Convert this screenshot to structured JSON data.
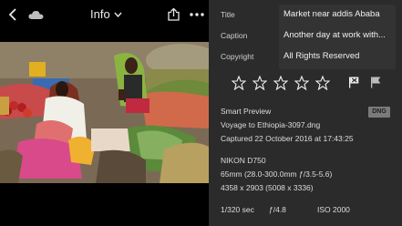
{
  "header": {
    "title": "Info",
    "icons": [
      "chevron-left-icon",
      "cloud-icon",
      "chevron-down-icon",
      "share-icon",
      "more-icon"
    ]
  },
  "photo": {
    "alt_icon": "market-photo"
  },
  "metadata": {
    "title_label": "Title",
    "title_value": "Market near addis Ababa",
    "caption_label": "Caption",
    "caption_value": "Another day at work with...",
    "copyright_label": "Copyright",
    "copyright_value": "All Rights Reserved"
  },
  "rating": {
    "stars_total": 5,
    "stars_filled": 0
  },
  "details": {
    "preview_type": "Smart Preview",
    "badge": "DNG",
    "filename": "Voyage to Ethiopia-3097.dng",
    "captured": "Captured 22 October 2016 at 17:43:25",
    "camera": "NIKON D750",
    "lens": "65mm (28.0-300.0mm ƒ/3.5-5.6)",
    "dimensions": "4358 x 2903 (5008 x 3336)",
    "shutter": "1/320 sec",
    "aperture": "ƒ/4.8",
    "iso": "ISO 2000"
  }
}
